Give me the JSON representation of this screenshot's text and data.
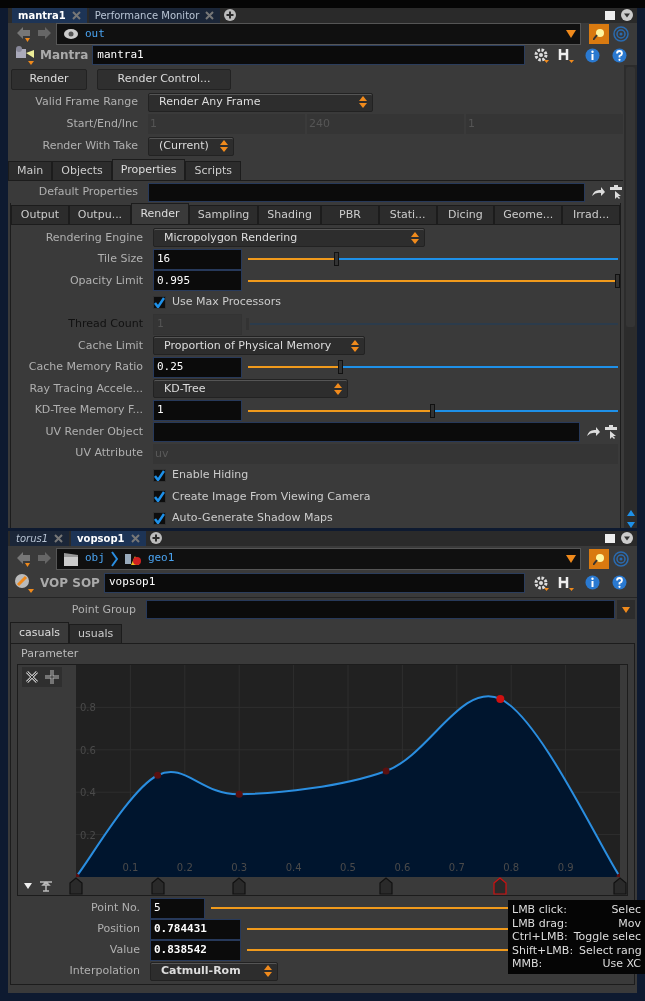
{
  "top_pane": {
    "tabs": [
      {
        "label": "mantra1",
        "selected": true
      },
      {
        "label": "Performance Monitor",
        "selected": false
      }
    ],
    "path": [
      {
        "label": "out"
      }
    ],
    "node_type": "Mantra",
    "node_name": "mantra1",
    "buttons": [
      "Render",
      "Render Control..."
    ],
    "header_params": [
      {
        "kind": "menu",
        "label": "Valid Frame Range",
        "value": "Render Any Frame"
      },
      {
        "kind": "triple",
        "label": "Start/End/Inc",
        "values": [
          "1",
          "240",
          "1"
        ],
        "disabled": true
      },
      {
        "kind": "menu",
        "label": "Render With Take",
        "value": "(Current)"
      }
    ],
    "folder_tabs": [
      {
        "label": "Main",
        "selected": false
      },
      {
        "label": "Objects",
        "selected": false
      },
      {
        "label": "Properties",
        "selected": true
      },
      {
        "label": "Scripts",
        "selected": false
      }
    ],
    "default_properties": {
      "label": "Default Properties"
    },
    "sub_tabs": [
      {
        "label": "Output",
        "selected": false
      },
      {
        "label": "Outpu...",
        "selected": false
      },
      {
        "label": "Render",
        "selected": true
      },
      {
        "label": "Sampling",
        "selected": false
      },
      {
        "label": "Shading",
        "selected": false
      },
      {
        "label": "PBR",
        "selected": false
      },
      {
        "label": "Stati...",
        "selected": false
      },
      {
        "label": "Dicing",
        "selected": false
      },
      {
        "label": "Geome...",
        "selected": false
      },
      {
        "label": "Irrad...",
        "selected": false
      }
    ],
    "params": [
      {
        "kind": "menu",
        "label": "Rendering Engine",
        "value": "Micropolygon Rendering"
      },
      {
        "kind": "slider",
        "label": "Tile Size",
        "value": "16",
        "level": 0.24,
        "disabled": false
      },
      {
        "kind": "slider",
        "label": "Opacity Limit",
        "value": "0.995",
        "level": 1,
        "disabled": false
      },
      {
        "kind": "checkbox",
        "label": "Use Max Processors",
        "checked": true
      },
      {
        "kind": "slider",
        "label": "Thread Count",
        "value": "1",
        "level": 0,
        "disabled": true
      },
      {
        "kind": "menu",
        "label": "Cache Limit",
        "value": "Proportion of Physical Memory"
      },
      {
        "kind": "slider",
        "label": "Cache Memory Ratio",
        "value": "0.25",
        "level": 0.25,
        "disabled": false
      },
      {
        "kind": "menu",
        "label": "Ray Tracing Accele...",
        "value": "KD-Tree"
      },
      {
        "kind": "slider",
        "label": "KD-Tree Memory F...",
        "value": "1",
        "level": 0.5,
        "disabled": false
      },
      {
        "kind": "path",
        "label": "UV Render Object"
      },
      {
        "kind": "text",
        "label": "UV Attribute",
        "placeholder": "uv",
        "disabled": true
      },
      {
        "kind": "checkbox",
        "label": "Enable Hiding",
        "checked": true
      },
      {
        "kind": "checkbox",
        "label": "Create Image From Viewing Camera",
        "checked": true
      },
      {
        "kind": "checkbox",
        "label": "Auto-Generate Shadow Maps",
        "checked": true
      }
    ]
  },
  "bottom_pane": {
    "tabs": [
      {
        "label": "torus1",
        "selected": false
      },
      {
        "label": "vopsop1",
        "selected": true
      }
    ],
    "path": [
      {
        "label": "obj"
      },
      {
        "label": "geo1"
      }
    ],
    "node_type": "VOP SOP",
    "node_name": "vopsop1",
    "point_group": {
      "label": "Point Group"
    },
    "folder_tabs": [
      {
        "label": "casuals",
        "selected": true
      },
      {
        "label": "usuals",
        "selected": false
      }
    ],
    "ramp": {
      "label": "Parameter",
      "keys": [
        {
          "selected": false
        },
        {
          "selected": false
        },
        {
          "selected": false
        },
        {
          "selected": false
        },
        {
          "selected": true
        },
        {
          "selected": false
        }
      ],
      "chart_data": {
        "type": "area",
        "grid": true,
        "x": [
          0,
          0.15,
          0.3,
          0.57,
          0.78,
          1
        ],
        "values": [
          0,
          0.48,
          0.39,
          0.5,
          0.84,
          0
        ],
        "xlim": [
          0,
          1
        ],
        "ylim": [
          0,
          1
        ],
        "xticks": [
          0.1,
          0.2,
          0.3,
          0.4,
          0.5,
          0.6,
          0.7,
          0.8,
          0.9
        ],
        "yticks": [
          0.2,
          0.4,
          0.6,
          0.8
        ]
      }
    },
    "key_params": [
      {
        "kind": "int",
        "label": "Point No.",
        "value": "5"
      },
      {
        "kind": "float",
        "label": "Position",
        "value": "0.784431"
      },
      {
        "kind": "float",
        "label": "Value",
        "value": "0.838542"
      },
      {
        "kind": "menu",
        "label": "Interpolation",
        "value": "Catmull-Rom"
      }
    ],
    "tooltip": [
      {
        "keys": "LMB click:",
        "action": "Selec"
      },
      {
        "keys": "LMB drag:",
        "action": "Mov"
      },
      {
        "keys": "Ctrl+LMB:",
        "action": "Toggle selec"
      },
      {
        "keys": "Shift+LMB:",
        "action": "Select rang"
      },
      {
        "keys": "MMB:",
        "action": "Use XC"
      }
    ]
  }
}
